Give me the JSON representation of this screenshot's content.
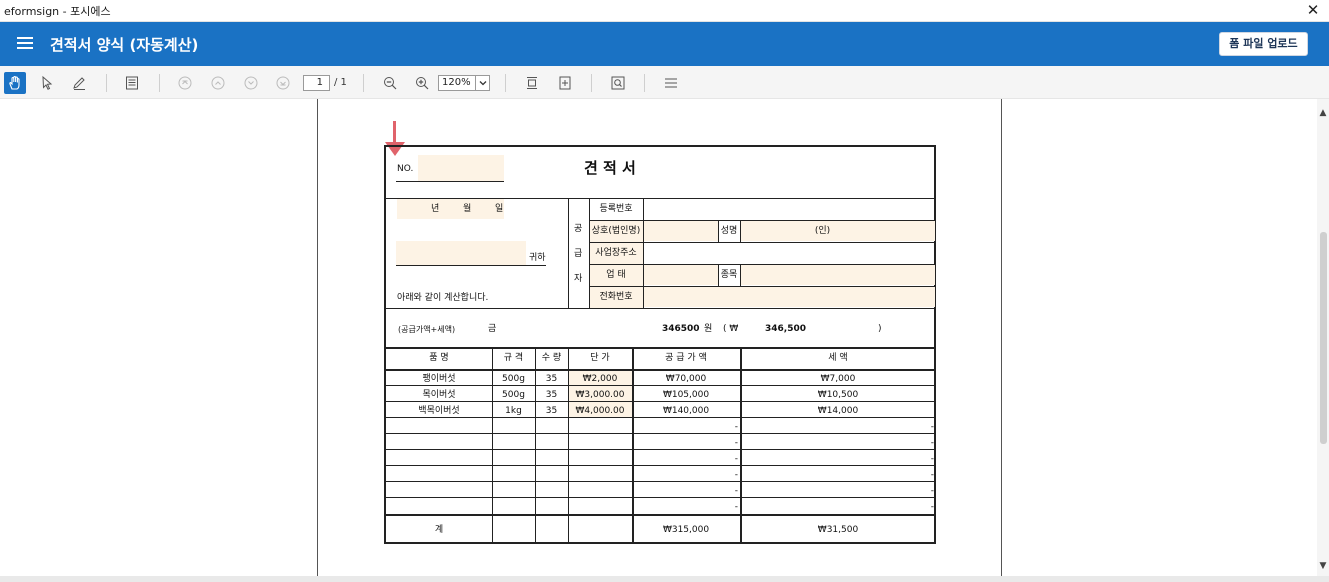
{
  "window": {
    "title": "eformsign - 포시에스"
  },
  "header": {
    "title": "견적서 양식 (자동계산)",
    "upload_label": "폼 파일 업로드"
  },
  "toolbar": {
    "page_current": "1",
    "page_total": "/ 1",
    "zoom": "120%"
  },
  "form": {
    "no_label": "NO.",
    "title": "견 적 서",
    "date": {
      "year": "년",
      "month": "월",
      "day": "일"
    },
    "recipient_suffix": "귀하",
    "note": "아래와 같이 계산합니다.",
    "supplier_label": [
      "공",
      "급",
      "자"
    ],
    "supplier_fields": {
      "reg_no": "등록번호",
      "company": "상호(법인명)",
      "name": "성명",
      "seal": "(인)",
      "address": "사업장주소",
      "business": "업 태",
      "item_type": "종목",
      "phone": "전화번호"
    },
    "total": {
      "label": "(공급가액+세액)",
      "geum": "금",
      "amount": "346500",
      "won": "원",
      "paren_open": "( ₩",
      "amount_fmt": "346,500",
      "paren_close": ")"
    },
    "columns": [
      "품 명",
      "규 격",
      "수 량",
      "단 가",
      "공 급 가 액",
      "세 액"
    ],
    "items": [
      {
        "name": "팽이버섯",
        "spec": "500g",
        "qty": "35",
        "price": "₩2,000",
        "supply": "₩70,000",
        "tax": "₩7,000"
      },
      {
        "name": "목이버섯",
        "spec": "500g",
        "qty": "35",
        "price": "₩3,000.00",
        "supply": "₩105,000",
        "tax": "₩10,500"
      },
      {
        "name": "백목이버섯",
        "spec": "1kg",
        "qty": "35",
        "price": "₩4,000.00",
        "supply": "₩140,000",
        "tax": "₩14,000"
      },
      {
        "supply": "-",
        "tax": "-"
      },
      {
        "supply": "-",
        "tax": "-"
      },
      {
        "supply": "-",
        "tax": "-"
      },
      {
        "supply": "-",
        "tax": "-"
      },
      {
        "supply": "-",
        "tax": "-"
      },
      {
        "supply": "-",
        "tax": "-"
      }
    ],
    "sum": {
      "label": "계",
      "supply": "₩315,000",
      "tax": "₩31,500"
    }
  },
  "colors": {
    "header": "#1a72c4",
    "field_fill": "#fdf3e5",
    "arrow": "#e0636b"
  }
}
